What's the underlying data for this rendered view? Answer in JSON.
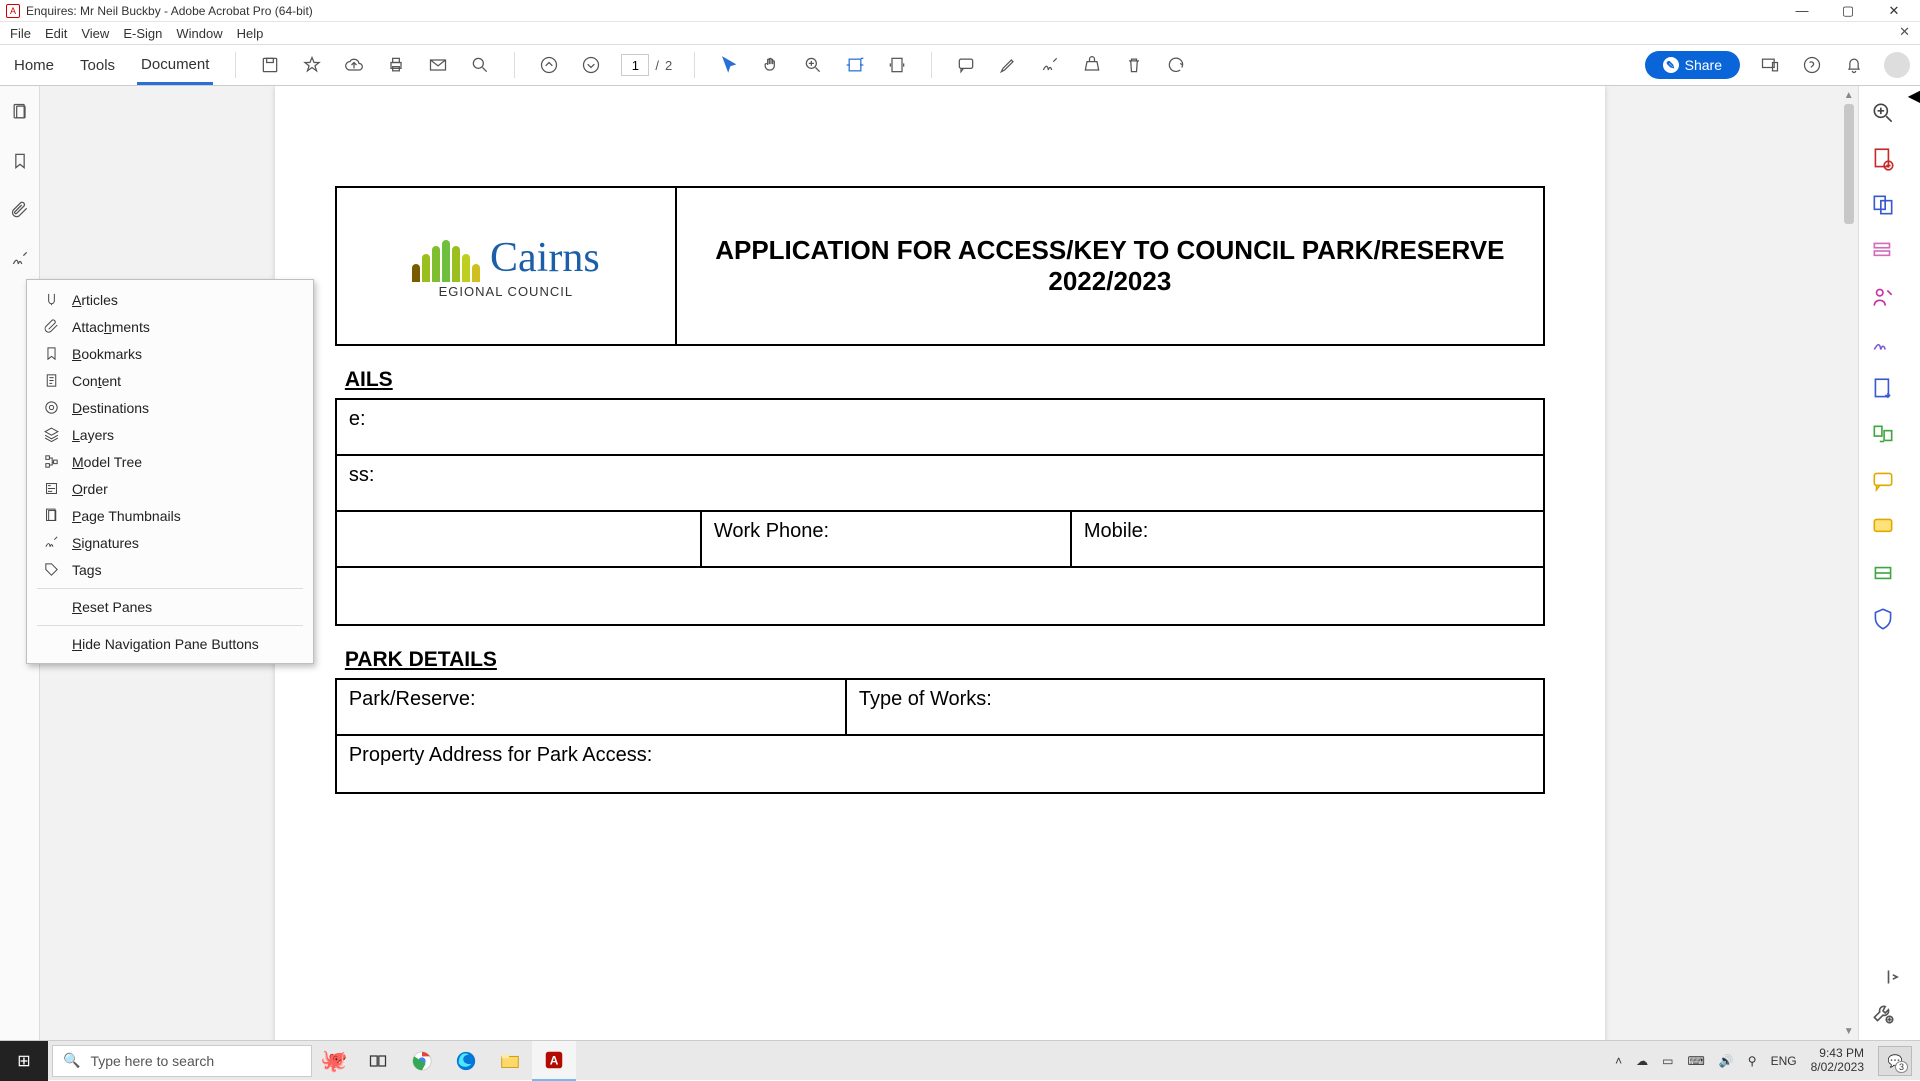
{
  "window": {
    "title": "Enquires: Mr Neil Buckby - Adobe Acrobat Pro (64-bit)"
  },
  "menubar": [
    "File",
    "Edit",
    "View",
    "E-Sign",
    "Window",
    "Help"
  ],
  "tabs": {
    "home": "Home",
    "tools": "Tools",
    "document": "Document"
  },
  "page_nav": {
    "current": "1",
    "total": "2",
    "sep": "/"
  },
  "share_label": "Share",
  "nav_popup": {
    "items": [
      {
        "key": "articles",
        "label": "Articles",
        "u": 0
      },
      {
        "key": "attachments",
        "label": "Attachments",
        "u": 5
      },
      {
        "key": "bookmarks",
        "label": "Bookmarks",
        "u": 0
      },
      {
        "key": "content",
        "label": "Content",
        "u": 3
      },
      {
        "key": "destinations",
        "label": "Destinations",
        "u": 0
      },
      {
        "key": "layers",
        "label": "Layers",
        "u": 0
      },
      {
        "key": "model-tree",
        "label": "Model Tree",
        "u": 0
      },
      {
        "key": "order",
        "label": "Order",
        "u": 0
      },
      {
        "key": "page-thumbnails",
        "label": "Page Thumbnails",
        "u": 0
      },
      {
        "key": "signatures",
        "label": "Signatures",
        "u": 0
      },
      {
        "key": "tags",
        "label": "Tags",
        "u": 2
      }
    ],
    "reset": "Reset Panes",
    "hide": "Hide Navigation Pane Buttons"
  },
  "document": {
    "logo_word": "Cairns",
    "logo_sub": "EGIONAL COUNCIL",
    "form_title": "APPLICATION FOR ACCESS/KEY TO COUNCIL PARK/RESERVE  2022/2023",
    "section1": "AILS",
    "s1_row1": "e:",
    "s1_row2": "ss:",
    "s1_work_phone": "Work Phone:",
    "s1_mobile": "Mobile:",
    "section2": "PARK DETAILS",
    "s2_park": "Park/Reserve:",
    "s2_type": "Type of Works:",
    "s2_prop": "Property Address for Park Access:"
  },
  "taskbar": {
    "search_placeholder": "Type here to search",
    "lang": "ENG",
    "time": "9:43 PM",
    "date": "8/02/2023",
    "notif_count": "3"
  }
}
